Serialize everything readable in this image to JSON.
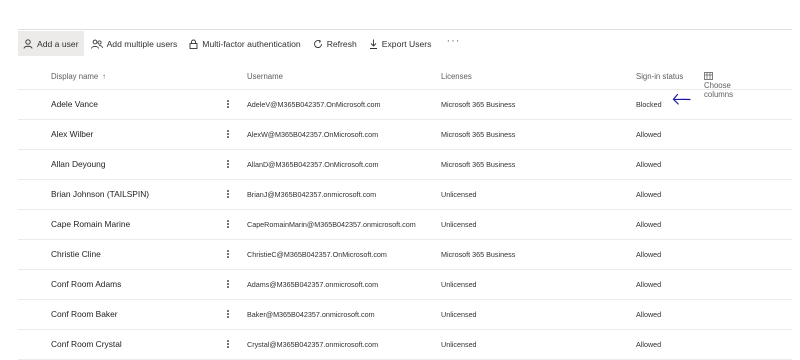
{
  "toolbar": {
    "add_user": "Add a user",
    "add_multiple": "Add multiple users",
    "mfa": "Multi-factor authentication",
    "refresh": "Refresh",
    "export": "Export Users",
    "more": "···"
  },
  "columns": {
    "display_name": "Display name",
    "sort_indicator": "↑",
    "username": "Username",
    "licenses": "Licenses",
    "sign_in_status": "Sign-in status",
    "choose_columns": "Choose columns"
  },
  "users": [
    {
      "name": "Adele Vance",
      "username": "AdeleV@M365B042357.OnMicrosoft.com",
      "license": "Microsoft 365 Business",
      "status": "Blocked"
    },
    {
      "name": "Alex Wilber",
      "username": "AlexW@M365B042357.OnMicrosoft.com",
      "license": "Microsoft 365 Business",
      "status": "Allowed"
    },
    {
      "name": "Allan Deyoung",
      "username": "AllanD@M365B042357.OnMicrosoft.com",
      "license": "Microsoft 365 Business",
      "status": "Allowed"
    },
    {
      "name": "Brian Johnson (TAILSPIN)",
      "username": "BrianJ@M365B042357.onmicrosoft.com",
      "license": "Unlicensed",
      "status": "Allowed"
    },
    {
      "name": "Cape Romain Marine",
      "username": "CapeRomainMarin@M365B042357.onmicrosoft.com",
      "license": "Unlicensed",
      "status": "Allowed"
    },
    {
      "name": "Christie Cline",
      "username": "ChristieC@M365B042357.OnMicrosoft.com",
      "license": "Microsoft 365 Business",
      "status": "Allowed"
    },
    {
      "name": "Conf Room Adams",
      "username": "Adams@M365B042357.onmicrosoft.com",
      "license": "Unlicensed",
      "status": "Allowed"
    },
    {
      "name": "Conf Room Baker",
      "username": "Baker@M365B042357.onmicrosoft.com",
      "license": "Unlicensed",
      "status": "Allowed"
    },
    {
      "name": "Conf Room Crystal",
      "username": "Crystal@M365B042357.onmicrosoft.com",
      "license": "Unlicensed",
      "status": "Allowed"
    }
  ],
  "colors": {
    "annotation_arrow": "#1a1aa6",
    "row_divider": "#edebe9",
    "active_command_bg": "#edebe9"
  },
  "icons": {
    "add_user": "person-icon",
    "add_multiple": "people-icon",
    "mfa": "lock-icon",
    "refresh": "refresh-icon",
    "export": "download-icon",
    "choose_columns": "columns-icon",
    "row_actions": "more-vertical-icon",
    "annotation": "hand-drawn-arrow-icon"
  }
}
